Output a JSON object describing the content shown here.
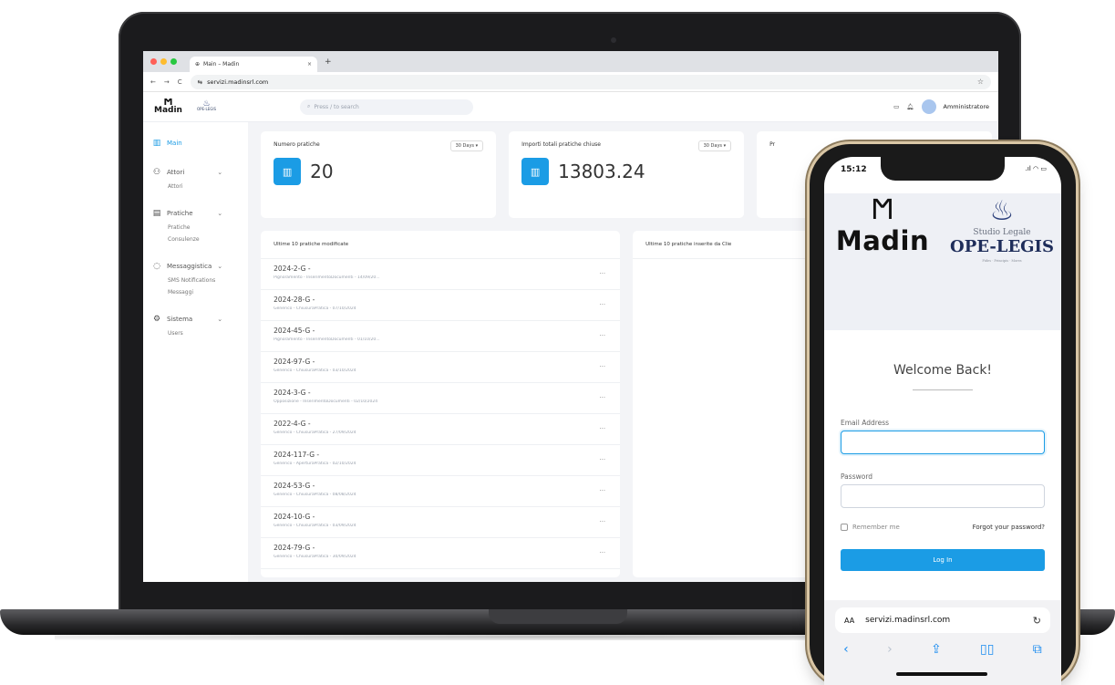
{
  "browser": {
    "tab_title": "Main – Madin",
    "tab_close": "×",
    "new_tab": "+",
    "url": "servizi.madinsrl.com"
  },
  "header": {
    "logo_main": "Madin",
    "logo_partner": "OPE-LEGIS",
    "search_placeholder": "Press / to search",
    "user_name": "Amministratore"
  },
  "sidebar": {
    "groups": [
      {
        "label": "Main",
        "icon": "chart-icon",
        "subitems": []
      },
      {
        "label": "Attori",
        "icon": "people-icon",
        "subitems": [
          "Attori"
        ]
      },
      {
        "label": "Pratiche",
        "icon": "folder-icon",
        "subitems": [
          "Pratiche",
          "Consulenze"
        ]
      },
      {
        "label": "Messaggistica",
        "icon": "chat-icon",
        "subitems": [
          "SMS Notifications",
          "Messaggi"
        ]
      },
      {
        "label": "Sistema",
        "icon": "gear-icon",
        "subitems": [
          "Users"
        ]
      }
    ]
  },
  "cards": [
    {
      "title": "Numero pratiche",
      "period": "30 Days",
      "value": "20"
    },
    {
      "title": "Importi totali pratiche chiuse",
      "period": "30 Days",
      "value": "13803.24"
    },
    {
      "title": "Pr"
    }
  ],
  "lists": {
    "left_title": "Ultime 10 pratiche modificate",
    "right_title": "Ultime 10 pratiche inserite da Clie",
    "rows": [
      {
        "code": "2024-2-G -",
        "desc": "Pignoramento - InserimentoDocumenti - 14/09/20..."
      },
      {
        "code": "2024-28-G -",
        "desc": "Generico - ChiusuraPratica - 07/10/2024"
      },
      {
        "code": "2024-45-G -",
        "desc": "Pignoramento - InserimentoDocumenti - 01/10/20..."
      },
      {
        "code": "2024-97-G -",
        "desc": "Generico - ChiusuraPratica - 03/10/2024"
      },
      {
        "code": "2024-3-G -",
        "desc": "Opposizione - InserimentoDocumenti - 02/10/2024"
      },
      {
        "code": "2022-4-G -",
        "desc": "Generico - ChiusuraPratica - 27/09/2024"
      },
      {
        "code": "2024-117-G -",
        "desc": "Generico - AperturaPratica - 02/10/2024"
      },
      {
        "code": "2024-53-G -",
        "desc": "Generico - ChiusuraPratica - 08/08/2024"
      },
      {
        "code": "2024-10-G -",
        "desc": "Generico - ChiusuraPratica - 03/09/2024"
      },
      {
        "code": "2024-79-G -",
        "desc": "Generico - ChiusuraPratica - 30/09/2024"
      }
    ],
    "more_label": "···"
  },
  "phone": {
    "time": "15:12",
    "brand_main": "Madin",
    "brand_studio": "Studio Legale",
    "brand_partner": "OPE-LEGIS",
    "brand_motto": "Fides · Principis · Mores",
    "welcome": "Welcome Back!",
    "email_label": "Email Address",
    "password_label": "Password",
    "remember_label": "Remember me",
    "forgot_label": "Forgot your password?",
    "login_label": "Log In",
    "url": "servizi.madinsrl.com",
    "aa": "AA"
  },
  "colors": {
    "accent": "#1b9ce5",
    "sidebar_active": "#1a9be4",
    "background": "#f3f4f7"
  }
}
